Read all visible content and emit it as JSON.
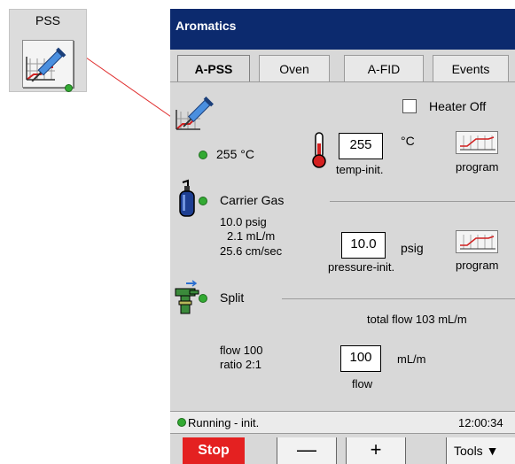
{
  "tile": {
    "label": "PSS",
    "icon": "syringe-chart-icon",
    "status_color": "#33aa33"
  },
  "window": {
    "title": "Aromatics"
  },
  "tabs": [
    {
      "label": "A-PSS",
      "active": true
    },
    {
      "label": "Oven",
      "active": false
    },
    {
      "label": "A-FID",
      "active": false
    },
    {
      "label": "Events",
      "active": false
    }
  ],
  "heater": {
    "label": "Heater Off",
    "checked": false
  },
  "temperature": {
    "actual": "255 °C",
    "setpoint": "255",
    "unit": "°C",
    "caption": "temp-init.",
    "program_label": "program"
  },
  "carrier": {
    "title": "Carrier Gas",
    "readings": [
      "10.0 psig",
      "2.1 mL/m",
      "25.6 cm/sec"
    ],
    "setpoint": "10.0",
    "unit": "psig",
    "caption": "pressure-init.",
    "program_label": "program"
  },
  "split": {
    "title": "Split",
    "total_flow": "total flow  103 mL/m",
    "readings": [
      "flow 100",
      "ratio 2:1"
    ],
    "setpoint": "100",
    "unit": "mL/m",
    "caption": "flow"
  },
  "status": {
    "text": "Running - init.",
    "time": "12:00:34"
  },
  "toolbar": {
    "stop": "Stop",
    "minus": "—",
    "plus": "+",
    "tools": "Tools ▼"
  },
  "colors": {
    "titlebar": "#0c2a6e",
    "stop": "#e42121",
    "ok": "#33aa33",
    "panel": "#d8d8d8"
  }
}
